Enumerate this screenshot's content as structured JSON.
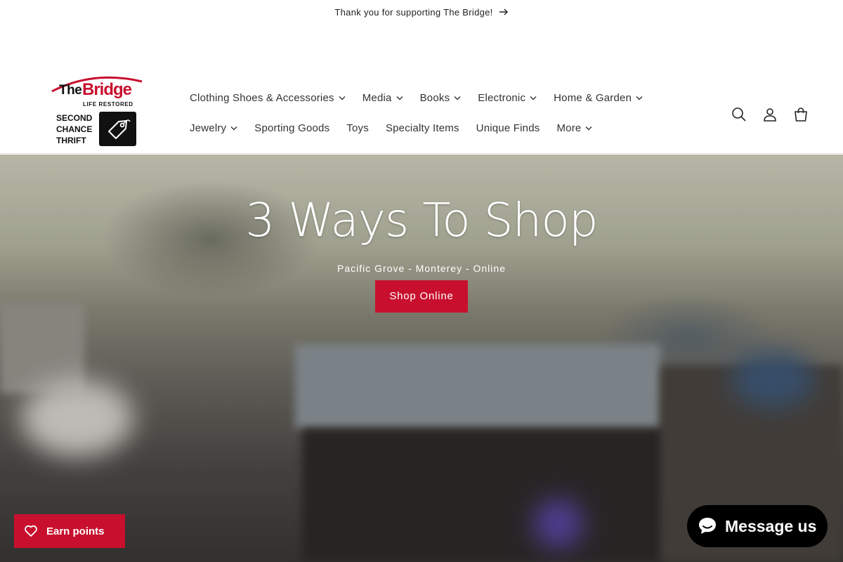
{
  "announcement": {
    "text": "Thank you for supporting The Bridge!",
    "icon": "arrow-right-icon"
  },
  "logo": {
    "the": "The",
    "bridge": "Bridge",
    "tagline": "LIFE RESTORED",
    "line1": "SECOND",
    "line2": "CHANCE",
    "line3": "THRIFT",
    "icon": "price-tag-icon"
  },
  "nav": {
    "row1": [
      {
        "label": "Clothing Shoes & Accessories",
        "has_dropdown": true
      },
      {
        "label": "Media",
        "has_dropdown": true
      },
      {
        "label": "Books",
        "has_dropdown": true
      },
      {
        "label": "Electronic",
        "has_dropdown": true
      },
      {
        "label": "Home & Garden",
        "has_dropdown": true
      }
    ],
    "row2": [
      {
        "label": "Jewelry",
        "has_dropdown": true
      },
      {
        "label": "Sporting Goods",
        "has_dropdown": false
      },
      {
        "label": "Toys",
        "has_dropdown": false
      },
      {
        "label": "Specialty Items",
        "has_dropdown": false
      },
      {
        "label": "Unique Finds",
        "has_dropdown": false
      },
      {
        "label": "More",
        "has_dropdown": true
      }
    ]
  },
  "header_icons": [
    "search-icon",
    "account-icon",
    "cart-icon"
  ],
  "hero": {
    "title": "3 Ways To Shop",
    "subtitle": "Pacific Grove - Monterey - Online",
    "button": "Shop Online"
  },
  "widgets": {
    "earn_points": "Earn points",
    "message": "Message us"
  },
  "colors": {
    "brand_red": "#c8102e",
    "dark": "#000000"
  }
}
